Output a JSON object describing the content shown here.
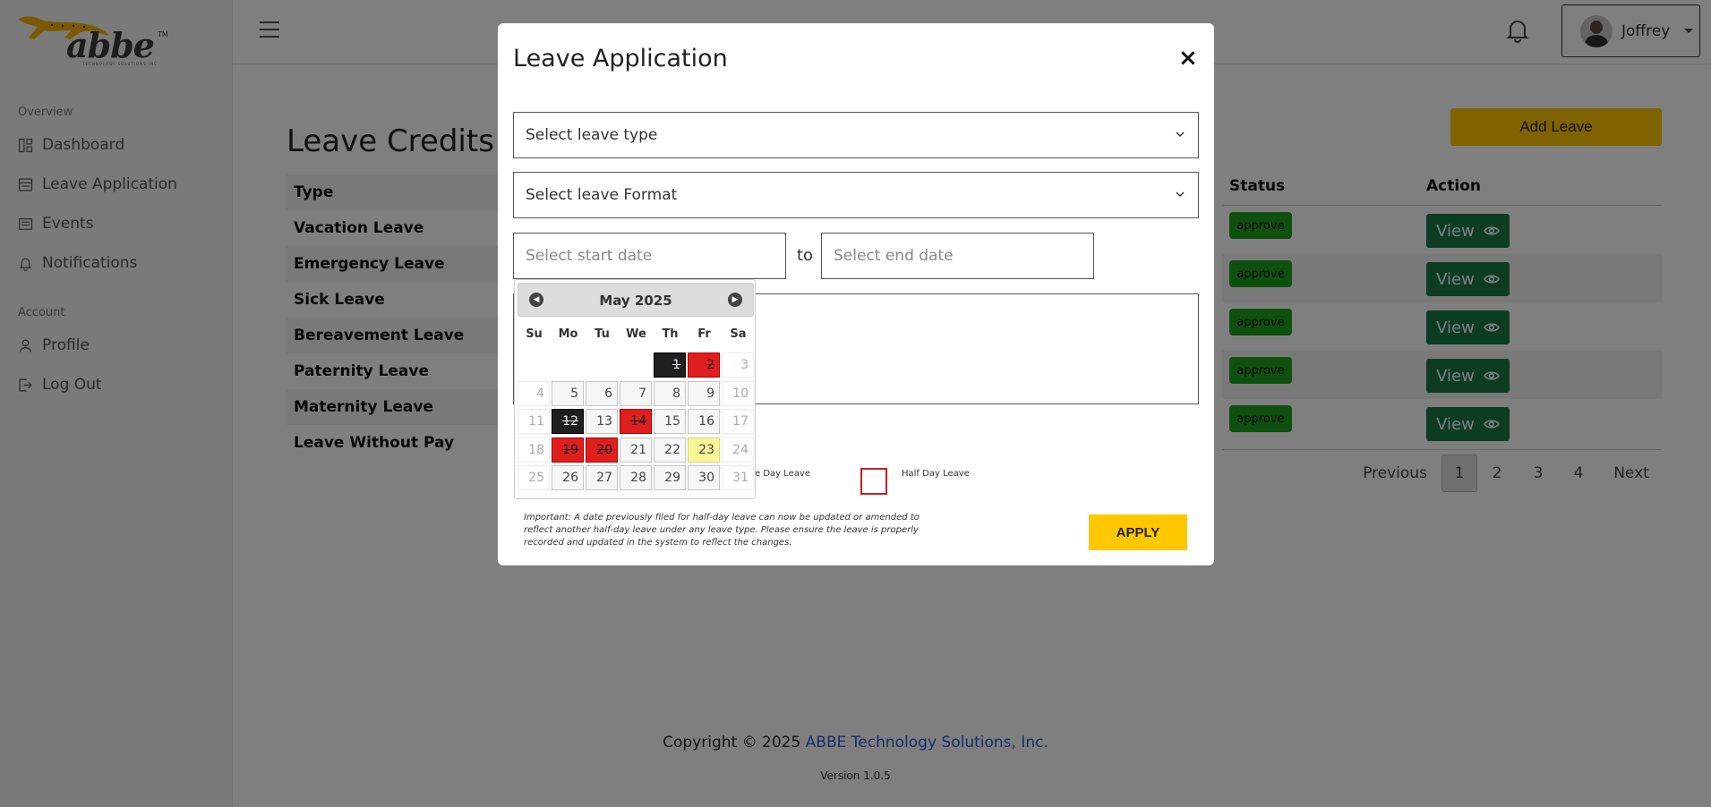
{
  "brand": {
    "logo_text": "abbe",
    "logo_tm": "TM",
    "logo_sub": "TECHNOLOGY SOLUTIONS INC"
  },
  "sidebar": {
    "section_overview": "Overview",
    "section_account": "Account",
    "items": [
      {
        "label": "Dashboard",
        "icon": "dashboard-icon"
      },
      {
        "label": "Leave Application",
        "icon": "form-icon"
      },
      {
        "label": "Events",
        "icon": "events-icon"
      },
      {
        "label": "Notifications",
        "icon": "bell-icon"
      },
      {
        "label": "Profile",
        "icon": "user-icon"
      },
      {
        "label": "Log Out",
        "icon": "logout-icon"
      }
    ]
  },
  "header": {
    "user_name": "Joffrey"
  },
  "main": {
    "title": "Leave Credits",
    "credits_header": "Type",
    "leave_types": [
      "Vacation Leave",
      "Emergency Leave",
      "Sick Leave",
      "Bereavement Leave",
      "Paternity Leave",
      "Maternity Leave",
      "Leave Without Pay"
    ],
    "add_leave_label": "Add Leave",
    "table_headers": {
      "status": "Status",
      "action": "Action"
    },
    "rows": [
      {
        "status": "approve",
        "action": "View"
      },
      {
        "status": "approve",
        "action": "View"
      },
      {
        "status": "approve",
        "action": "View"
      },
      {
        "status": "approve",
        "action": "View"
      },
      {
        "status": "approve",
        "action": "View"
      }
    ],
    "pagination": {
      "previous": "Previous",
      "pages": [
        "1",
        "2",
        "3",
        "4"
      ],
      "next": "Next",
      "current": "1"
    }
  },
  "footer": {
    "copyright": "Copyright © 2025",
    "company": "ABBE Technology Solutions, Inc.",
    "version": "Version 1.0.5"
  },
  "modal": {
    "title": "Leave Application",
    "close": "×",
    "leave_type_placeholder": "Select leave type",
    "leave_format_placeholder": "Select leave Format",
    "start_date_placeholder": "Select start date",
    "to_label": "to",
    "end_date_placeholder": "Select end date",
    "checkbox_whole_label": "e Day Leave",
    "checkbox_half_label": "Half Day Leave",
    "note": "Important: A date previously filed for half-day leave can now be updated or amended to reflect another half-day leave under any leave type. Please ensure the leave is properly recorded and updated in the system to reflect the changes.",
    "apply_label": "APPLY"
  },
  "datepicker": {
    "title": "May 2025",
    "days_of_week": [
      "Su",
      "Mo",
      "Tu",
      "We",
      "Th",
      "Fr",
      "Sa"
    ],
    "weeks": [
      [
        null,
        null,
        null,
        null,
        {
          "d": "1",
          "s": "black"
        },
        {
          "d": "2",
          "s": "red"
        },
        {
          "d": "3",
          "s": "muted"
        }
      ],
      [
        {
          "d": "4",
          "s": "muted"
        },
        {
          "d": "5",
          "s": ""
        },
        {
          "d": "6",
          "s": ""
        },
        {
          "d": "7",
          "s": ""
        },
        {
          "d": "8",
          "s": ""
        },
        {
          "d": "9",
          "s": ""
        },
        {
          "d": "10",
          "s": "muted"
        }
      ],
      [
        {
          "d": "11",
          "s": "muted"
        },
        {
          "d": "12",
          "s": "black"
        },
        {
          "d": "13",
          "s": ""
        },
        {
          "d": "14",
          "s": "red"
        },
        {
          "d": "15",
          "s": ""
        },
        {
          "d": "16",
          "s": ""
        },
        {
          "d": "17",
          "s": "muted"
        }
      ],
      [
        {
          "d": "18",
          "s": "muted"
        },
        {
          "d": "19",
          "s": "red"
        },
        {
          "d": "20",
          "s": "red"
        },
        {
          "d": "21",
          "s": ""
        },
        {
          "d": "22",
          "s": ""
        },
        {
          "d": "23",
          "s": "hl"
        },
        {
          "d": "24",
          "s": "muted"
        }
      ],
      [
        {
          "d": "25",
          "s": "muted"
        },
        {
          "d": "26",
          "s": ""
        },
        {
          "d": "27",
          "s": ""
        },
        {
          "d": "28",
          "s": ""
        },
        {
          "d": "29",
          "s": ""
        },
        {
          "d": "30",
          "s": ""
        },
        {
          "d": "31",
          "s": "muted"
        }
      ]
    ]
  },
  "colors": {
    "accent": "#ffc700",
    "success": "#1fa01f",
    "view_button": "#197a45",
    "blocked_red": "#e01e1e",
    "today": "#fbf598"
  }
}
